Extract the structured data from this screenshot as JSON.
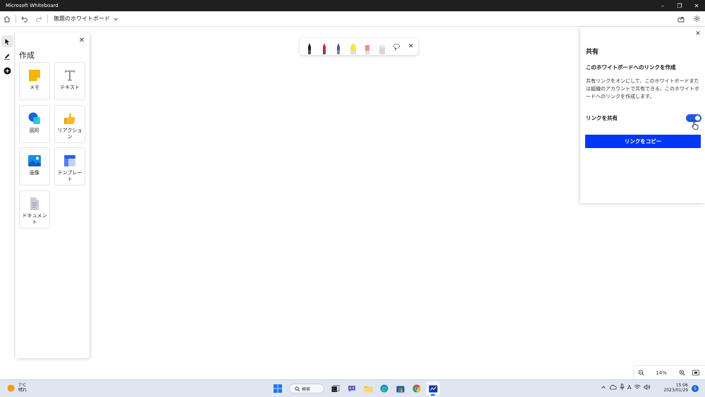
{
  "window": {
    "title": "Microsoft Whiteboard",
    "minimize": "–",
    "maximize": "❐",
    "close": "✕"
  },
  "toolbar": {
    "board_name": "無題のホワイトボード"
  },
  "create_panel": {
    "title": "作成",
    "close": "✕",
    "tiles": [
      {
        "label": "メモ"
      },
      {
        "label": "テキスト"
      },
      {
        "label": "図形"
      },
      {
        "label": "リアクション"
      },
      {
        "label": "画像"
      },
      {
        "label": "テンプレート"
      },
      {
        "label": "ドキュメント"
      }
    ]
  },
  "pen_toolbar": {
    "pens": [
      {
        "name": "black-pen",
        "color": "#222222"
      },
      {
        "name": "red-pen",
        "color": "#e0262f"
      },
      {
        "name": "blue-pen",
        "color": "#4a5aa8"
      },
      {
        "name": "yellow-highlighter",
        "color": "#f4e94a"
      },
      {
        "name": "pink-highlighter",
        "color": "#f08a9a"
      },
      {
        "name": "eraser",
        "color": "#d8d8d8"
      }
    ],
    "close": "✕"
  },
  "share_panel": {
    "close": "✕",
    "title": "共有",
    "subtitle": "このホワイトボードへのリンクを作成",
    "description": "共有リンクをオンにして、このホワイトボードまたは組織のアカウントで共有できる、このホワイトボードへのリンクを作成します。",
    "toggle_label": "リンクを共有",
    "toggle_on": true,
    "copy_button": "リンクをコピー",
    "accent": "#0036f5"
  },
  "zoom": {
    "value": "14%"
  },
  "taskbar": {
    "weather_temp": "7°C",
    "weather_desc": "晴れ",
    "search_label": "検索",
    "time": "15:06",
    "date": "2023/01/29",
    "notifications": "5",
    "ime": "A"
  }
}
